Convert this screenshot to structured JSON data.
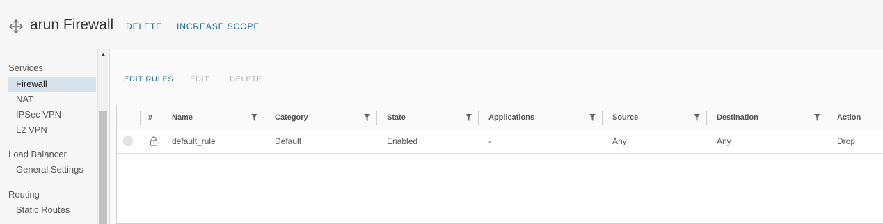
{
  "header": {
    "title": "arun Firewall",
    "icon": "move-arrows-icon",
    "actions": {
      "delete": "DELETE",
      "increase_scope": "INCREASE SCOPE"
    }
  },
  "sidebar": {
    "groups": [
      {
        "label": "Services",
        "items": [
          "Firewall",
          "NAT",
          "IPSec VPN",
          "L2 VPN"
        ]
      },
      {
        "label": "Load Balancer",
        "items": [
          "General Settings"
        ]
      },
      {
        "label": "Routing",
        "items": [
          "Static Routes"
        ]
      }
    ],
    "active_item": "Firewall"
  },
  "toolbar": {
    "edit_rules": "EDIT RULES",
    "edit": "EDIT",
    "delete": "DELETE"
  },
  "grid": {
    "columns": [
      "#",
      "Name",
      "Category",
      "State",
      "Applications",
      "Source",
      "Destination",
      "Action"
    ],
    "rows": [
      {
        "name": "default_rule",
        "category": "Default",
        "state": "Enabled",
        "applications": "-",
        "source": "Any",
        "destination": "Any",
        "action": "Drop",
        "locked": true
      }
    ]
  },
  "colors": {
    "link": "#1a6a8f",
    "active_bg": "#d6e3ec",
    "disabled": "#a9a9a9"
  }
}
